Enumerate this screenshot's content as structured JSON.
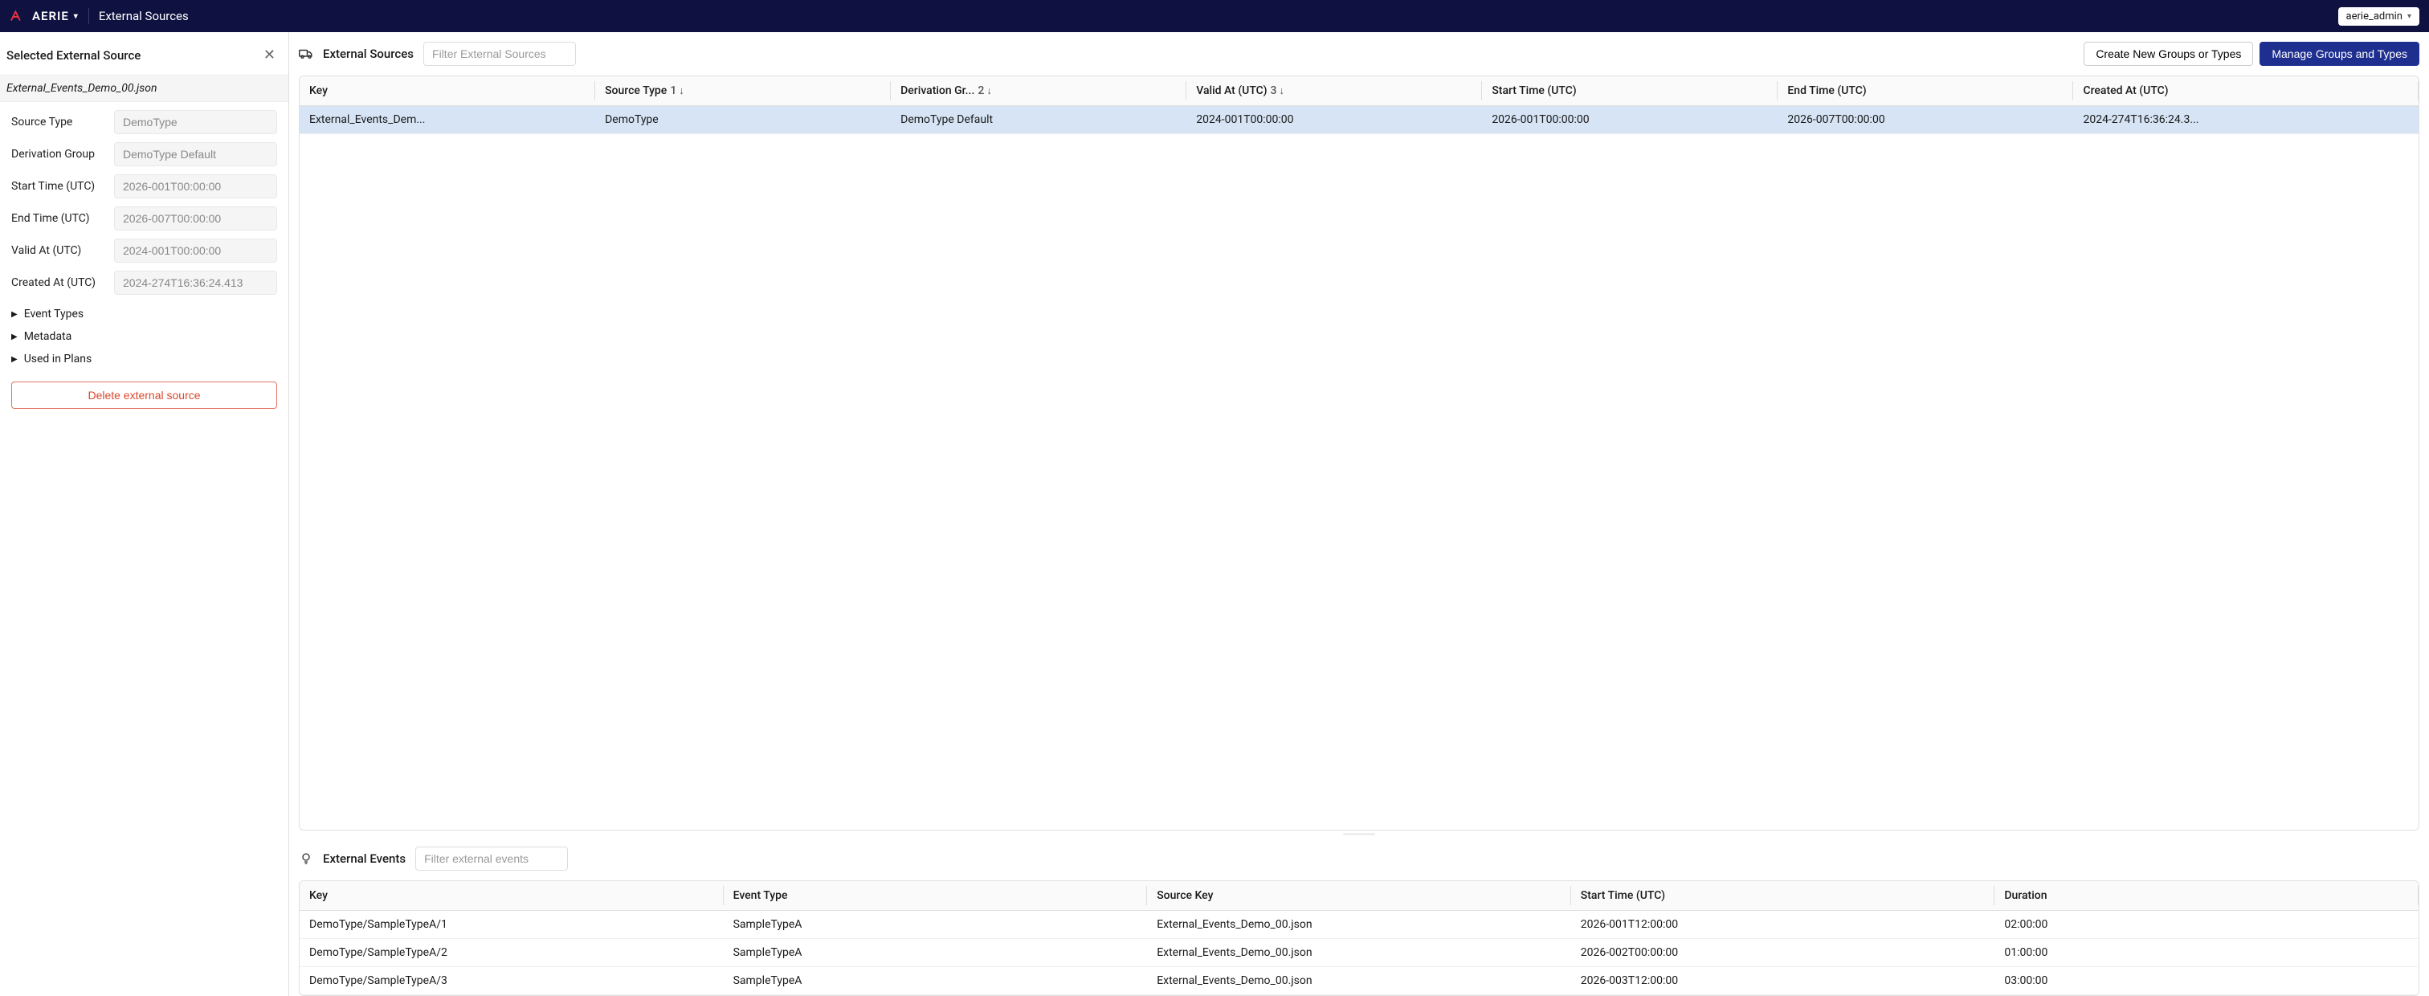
{
  "header": {
    "logo_text": "AERIE",
    "page_title": "External Sources",
    "user": "aerie_admin"
  },
  "sidebar": {
    "title": "Selected External Source",
    "source_name": "External_Events_Demo_00.json",
    "fields": {
      "source_type_label": "Source Type",
      "source_type_value": "DemoType",
      "derivation_group_label": "Derivation Group",
      "derivation_group_value": "DemoType Default",
      "start_time_label": "Start Time (UTC)",
      "start_time_value": "2026-001T00:00:00",
      "end_time_label": "End Time (UTC)",
      "end_time_value": "2026-007T00:00:00",
      "valid_at_label": "Valid At (UTC)",
      "valid_at_value": "2024-001T00:00:00",
      "created_at_label": "Created At (UTC)",
      "created_at_value": "2024-274T16:36:24.413"
    },
    "expandables": {
      "event_types": "Event Types",
      "metadata": "Metadata",
      "used_in_plans": "Used in Plans"
    },
    "delete_label": "Delete external source"
  },
  "sources_section": {
    "title": "External Sources",
    "filter_placeholder": "Filter External Sources",
    "create_btn": "Create New Groups or Types",
    "manage_btn": "Manage Groups and Types",
    "columns": {
      "key": "Key",
      "source_type": "Source Type",
      "source_type_sort": "1",
      "derivation_group": "Derivation Gr...",
      "derivation_group_sort": "2",
      "valid_at": "Valid At (UTC)",
      "valid_at_sort": "3",
      "start_time": "Start Time (UTC)",
      "end_time": "End Time (UTC)",
      "created_at": "Created At (UTC)"
    },
    "rows": [
      {
        "key": "External_Events_Dem...",
        "source_type": "DemoType",
        "derivation_group": "DemoType Default",
        "valid_at": "2024-001T00:00:00",
        "start_time": "2026-001T00:00:00",
        "end_time": "2026-007T00:00:00",
        "created_at": "2024-274T16:36:24.3..."
      }
    ]
  },
  "events_section": {
    "title": "External Events",
    "filter_placeholder": "Filter external events",
    "columns": {
      "key": "Key",
      "event_type": "Event Type",
      "source_key": "Source Key",
      "start_time": "Start Time (UTC)",
      "duration": "Duration"
    },
    "rows": [
      {
        "key": "DemoType/SampleTypeA/1",
        "event_type": "SampleTypeA",
        "source_key": "External_Events_Demo_00.json",
        "start_time": "2026-001T12:00:00",
        "duration": "02:00:00"
      },
      {
        "key": "DemoType/SampleTypeA/2",
        "event_type": "SampleTypeA",
        "source_key": "External_Events_Demo_00.json",
        "start_time": "2026-002T00:00:00",
        "duration": "01:00:00"
      },
      {
        "key": "DemoType/SampleTypeA/3",
        "event_type": "SampleTypeA",
        "source_key": "External_Events_Demo_00.json",
        "start_time": "2026-003T12:00:00",
        "duration": "03:00:00"
      }
    ]
  }
}
